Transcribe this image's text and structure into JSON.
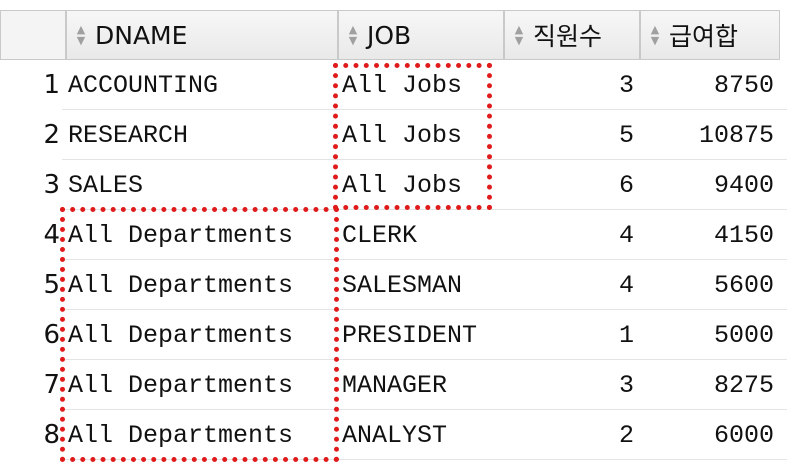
{
  "table": {
    "columns": [
      {
        "label": "DNAME",
        "sort_icon": "sort-arrows-icon"
      },
      {
        "label": "JOB",
        "sort_icon": "sort-arrows-icon"
      },
      {
        "label": "직원수",
        "sort_icon": "sort-arrows-icon"
      },
      {
        "label": "급여합",
        "sort_icon": "sort-arrows-icon"
      }
    ],
    "rows": [
      {
        "num": "1",
        "dname": "ACCOUNTING",
        "job": "All Jobs",
        "count": "3",
        "sum": "8750"
      },
      {
        "num": "2",
        "dname": "RESEARCH",
        "job": "All Jobs",
        "count": "5",
        "sum": "10875"
      },
      {
        "num": "3",
        "dname": "SALES",
        "job": "All Jobs",
        "count": "6",
        "sum": "9400"
      },
      {
        "num": "4",
        "dname": "All Departments",
        "job": "CLERK",
        "count": "4",
        "sum": "4150"
      },
      {
        "num": "5",
        "dname": "All Departments",
        "job": "SALESMAN",
        "count": "4",
        "sum": "5600"
      },
      {
        "num": "6",
        "dname": "All Departments",
        "job": "PRESIDENT",
        "count": "1",
        "sum": "5000"
      },
      {
        "num": "7",
        "dname": "All Departments",
        "job": "MANAGER",
        "count": "3",
        "sum": "8275"
      },
      {
        "num": "8",
        "dname": "All Departments",
        "job": "ANALYST",
        "count": "2",
        "sum": "6000"
      }
    ]
  },
  "colors": {
    "highlight": "#e01b1b",
    "header_bg": "#eeeeee",
    "grid_line": "#e4e4e4"
  }
}
